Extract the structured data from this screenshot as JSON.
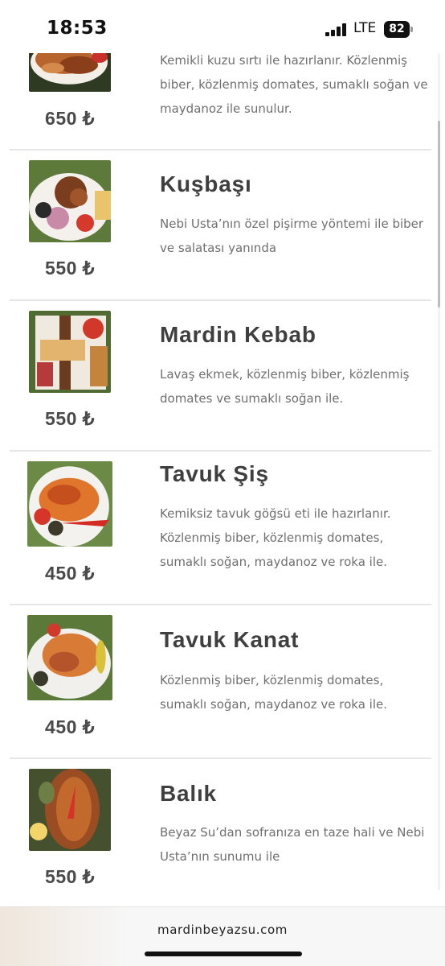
{
  "status_bar": {
    "time": "18:53",
    "network": "LTE",
    "battery": "82",
    "icons": [
      "signal-icon",
      "battery-icon"
    ]
  },
  "menu": {
    "items": [
      {
        "name": "",
        "description": "Kemikli kuzu sırtı ile hazırlanır. Közlenmiş biber, közlenmiş domates, sumaklı soğan ve maydanoz ile sunulur.",
        "price": "650 ₺",
        "photo": "lamb-ribs-photo"
      },
      {
        "name": "Kuşbaşı",
        "description": "Nebi Usta’nın özel pişirme yöntemi ile biber ve salatası yanında",
        "price": "550 ₺",
        "photo": "kusbasi-photo"
      },
      {
        "name": "Mardin Kebab",
        "description": "Lavaş ekmek, közlenmiş biber, közlenmiş domates ve sumaklı soğan ile.",
        "price": "550 ₺",
        "photo": "mardin-kebab-photo"
      },
      {
        "name": "Tavuk Şiş",
        "description": "Kemiksiz tavuk göğsü eti ile hazırlanır. Közlenmiş biber, közlenmiş domates, sumaklı soğan, maydanoz ve roka ile.",
        "price": "450 ₺",
        "photo": "tavuk-sis-photo"
      },
      {
        "name": "Tavuk Kanat",
        "description": "Közlenmiş biber, közlenmiş domates, sumaklı soğan, maydanoz ve roka ile.",
        "price": "450 ₺",
        "photo": "tavuk-kanat-photo"
      },
      {
        "name": "Balık",
        "description": "Beyaz Su’dan sofranıza en taze hali ve Nebi Usta’nın sunumu ile",
        "price": "550 ₺",
        "photo": "balik-photo"
      }
    ]
  },
  "browser": {
    "url": "mardinbeyazsu.com"
  },
  "colors": {
    "text_dark": "#3f3f3f",
    "text_muted": "#6f6f6f",
    "divider": "#e6e6e6"
  }
}
